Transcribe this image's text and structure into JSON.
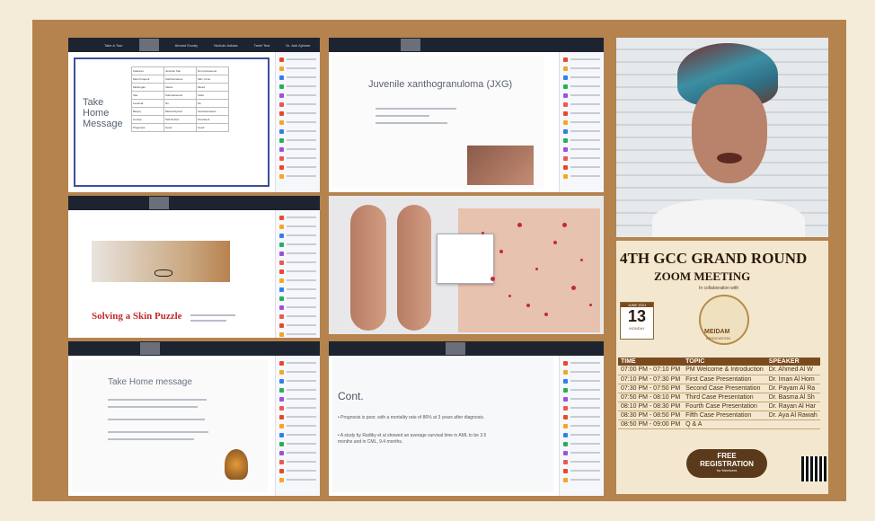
{
  "tile1": {
    "slide_title": "Take\nHome\nMessage",
    "zoom_names": [
      "Take A Tour",
      "Ahmed Ezzaly",
      "Nichole Adidas",
      "Tamil Test",
      "Dr. Ash Ajinmer"
    ],
    "table": [
      [
        "Features",
        "Juvenile Xan",
        "Non-Cutaneous"
      ],
      [
        "Most frequent",
        "Xanthomatous",
        "Skin, bone"
      ],
      [
        "Multiorgan",
        "Varies",
        "Mixed"
      ],
      [
        "Site",
        "Subcutaneous",
        "Solid"
      ],
      [
        "Lesional",
        "No",
        "No"
      ],
      [
        "Biopsy",
        "Mesenchymal",
        "Granulomatous"
      ],
      [
        "Course",
        "Self-limited",
        "Persistent"
      ],
      [
        "Prognosis",
        "Good",
        "Good"
      ]
    ]
  },
  "tile2": {
    "slide_title": "Juvenile xanthogranuloma (JXG)"
  },
  "tile4": {
    "slide_title": "Solving a Skin Puzzle"
  },
  "tile7": {
    "slide_title": "Take Home message"
  },
  "tile8": {
    "slide_title": "Cont.",
    "bullets": [
      "• Prognosis is poor, with a mortality rate of 86% at 3 years after diagnosis.",
      "• A study by Radtky et al showed an average survival time in AML to be 3.5 months and in CML, 9.4 months."
    ]
  },
  "poster": {
    "title": "4TH GCC GRAND ROUND",
    "subtitle": "ZOOM MEETING",
    "collab": "In collaboration with",
    "month": "JUNE 2021",
    "day": "13",
    "weekday": "MONDAY",
    "time_note": "7:00 PM",
    "assoc_name": "MEIDAM",
    "assoc_sub": "ASSOCIATION",
    "headers": [
      "TIME",
      "TOPIC",
      "SPEAKER"
    ],
    "rows": [
      [
        "07:00 PM - 07:10 PM",
        "PM Welcome & Introduction",
        "Dr. Ahmed Al W"
      ],
      [
        "07:10 PM - 07:30 PM",
        "First Case Presentation",
        "Dr. Iman Al Hom"
      ],
      [
        "07:30 PM - 07:50 PM",
        "Second Case Presentation",
        "Dr. Payam Al Ra"
      ],
      [
        "07:50 PM - 08:10 PM",
        "Third Case Presentation",
        "Dr. Basma Al Sh"
      ],
      [
        "08:10 PM - 08:30 PM",
        "Fourth Case Presentation",
        "Dr. Rayan Al Har"
      ],
      [
        "08:30 PM - 08:50 PM",
        "Fifth Case Presentation",
        "Dr. Aya Al Rawah"
      ],
      [
        "08:50 PM - 09:00 PM",
        "Q & A",
        ""
      ]
    ],
    "cta_line1": "FREE",
    "cta_line2": "REGISTRATION",
    "cta_line3": "for Members"
  }
}
